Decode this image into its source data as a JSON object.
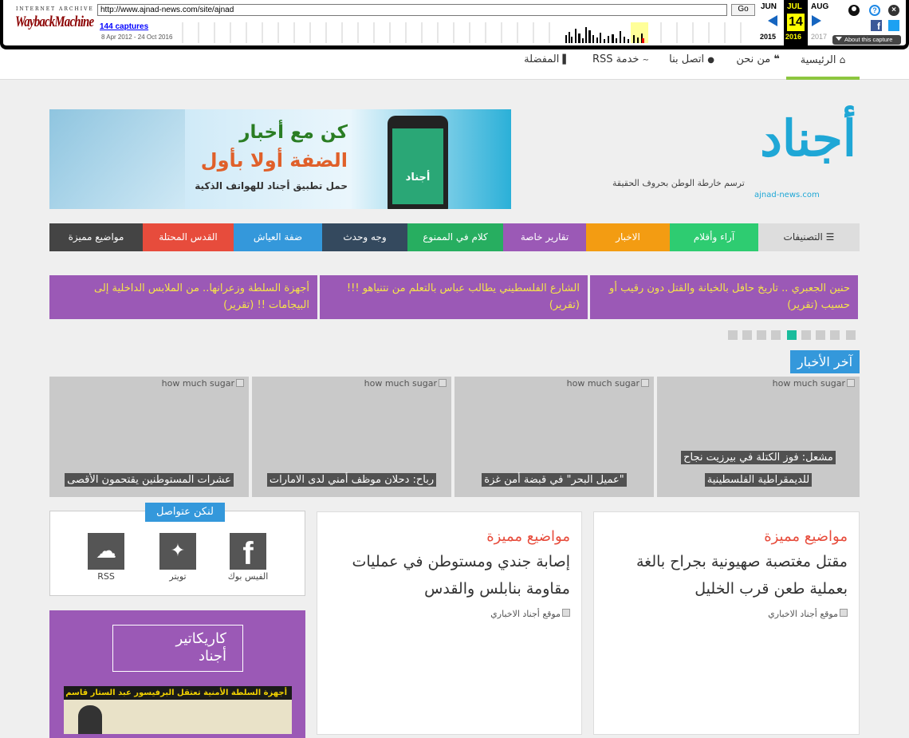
{
  "wayback": {
    "logo_top": "INTERNET ARCHIVE",
    "logo_main": "WaybackMachine",
    "url": "http://www.ajnad-news.com/site/ajnad",
    "go_label": "Go",
    "captures": "144 captures",
    "date_range": "8 Apr 2012 - 24 Oct 2016",
    "months": {
      "prev": "JUN",
      "current": "JUL",
      "next": "AUG"
    },
    "day": "14",
    "years": {
      "prev": "2015",
      "current": "2016",
      "next": "2017"
    },
    "about_label": "About this capture"
  },
  "nav": {
    "items": [
      {
        "label": "الرئيسية",
        "icon": "home-icon"
      },
      {
        "label": "من نحن",
        "icon": "quote-icon"
      },
      {
        "label": "اتصل بنا",
        "icon": "drop-icon"
      },
      {
        "label": "خدمة RSS",
        "icon": "rss-icon"
      },
      {
        "label": "المفضلة",
        "icon": "bar-chart-icon"
      }
    ]
  },
  "logo": {
    "name": "أجناد",
    "tagline": "ترسم خارطة الوطن بحروف الحقيقة",
    "domain": "ajnad-news.com"
  },
  "banner": {
    "line1": "كن مع أخبار",
    "line2": "الضفة أولا بأول",
    "line3": "حمل تطبيق أجناد للهواتف الذكية",
    "phone_label": "أجناد"
  },
  "categories": [
    {
      "label": "التصنيفات",
      "color": "#dddddd"
    },
    {
      "label": "آراء وأقلام",
      "color": "#2ecc71"
    },
    {
      "label": "الاخبار",
      "color": "#f39c12"
    },
    {
      "label": "تقارير خاصة",
      "color": "#9b59b6"
    },
    {
      "label": "كلام في الممنوع",
      "color": "#27ae60"
    },
    {
      "label": "وجه وحدث",
      "color": "#34495e"
    },
    {
      "label": "ضفة العياش",
      "color": "#3498db"
    },
    {
      "label": "القدس المحتلة",
      "color": "#e74c3c"
    },
    {
      "label": "مواضيع مميزة",
      "color": "#444444"
    }
  ],
  "ticker": [
    "حنين الجعبري .. تاريخ حافل بالخيانة والقتل دون رقيب أو حسيب (تقرير)",
    "الشارع الفلسطيني يطالب عباس بالتعلم من نتنياهو !!! (تقرير)",
    "أجهزة السلطة وزعرانها.. من الملابس الداخلية إلى البيجامات !! (تقرير)"
  ],
  "slider": {
    "total": 9,
    "active": 5
  },
  "latest": {
    "title": "آخر الأخبار",
    "img_alt": "how much sugar",
    "items": [
      "مشعل: فوز الكتلة في بيرزيت نجاح للديمقراطية الفلسطينية",
      "\"عميل البحر\" في قبضة أمن غزة",
      "رباح: دحلان موظف أمني لدى الامارات",
      "عشرات المستوطنين يقتحمون الأقصى"
    ]
  },
  "featured": [
    {
      "label": "مواضيع مميزة",
      "title": "مقتل مغتصبة صهيونية بجراح بالغة بعملية طعن قرب الخليل",
      "img_alt": "موقع أجناد الاخباري"
    },
    {
      "label": "مواضيع مميزة",
      "title": "إصابة جندي ومستوطن في عمليات مقاومة بنابلس والقدس",
      "img_alt": "موقع أجناد الاخباري"
    }
  ],
  "social": {
    "title": "لنكن عتواصل",
    "items": [
      {
        "label": "الفيس بوك",
        "icon": "facebook-icon"
      },
      {
        "label": "تويتر",
        "icon": "twitter-icon"
      },
      {
        "label": "RSS",
        "icon": "rss-icon"
      }
    ]
  },
  "caricature": {
    "title_line1": "كاريكاتير",
    "title_line2": "أجناد",
    "img_caption": "أجهزة السلطة الأمنية تعتقل البرفيسور عبد الستار قاسم"
  }
}
